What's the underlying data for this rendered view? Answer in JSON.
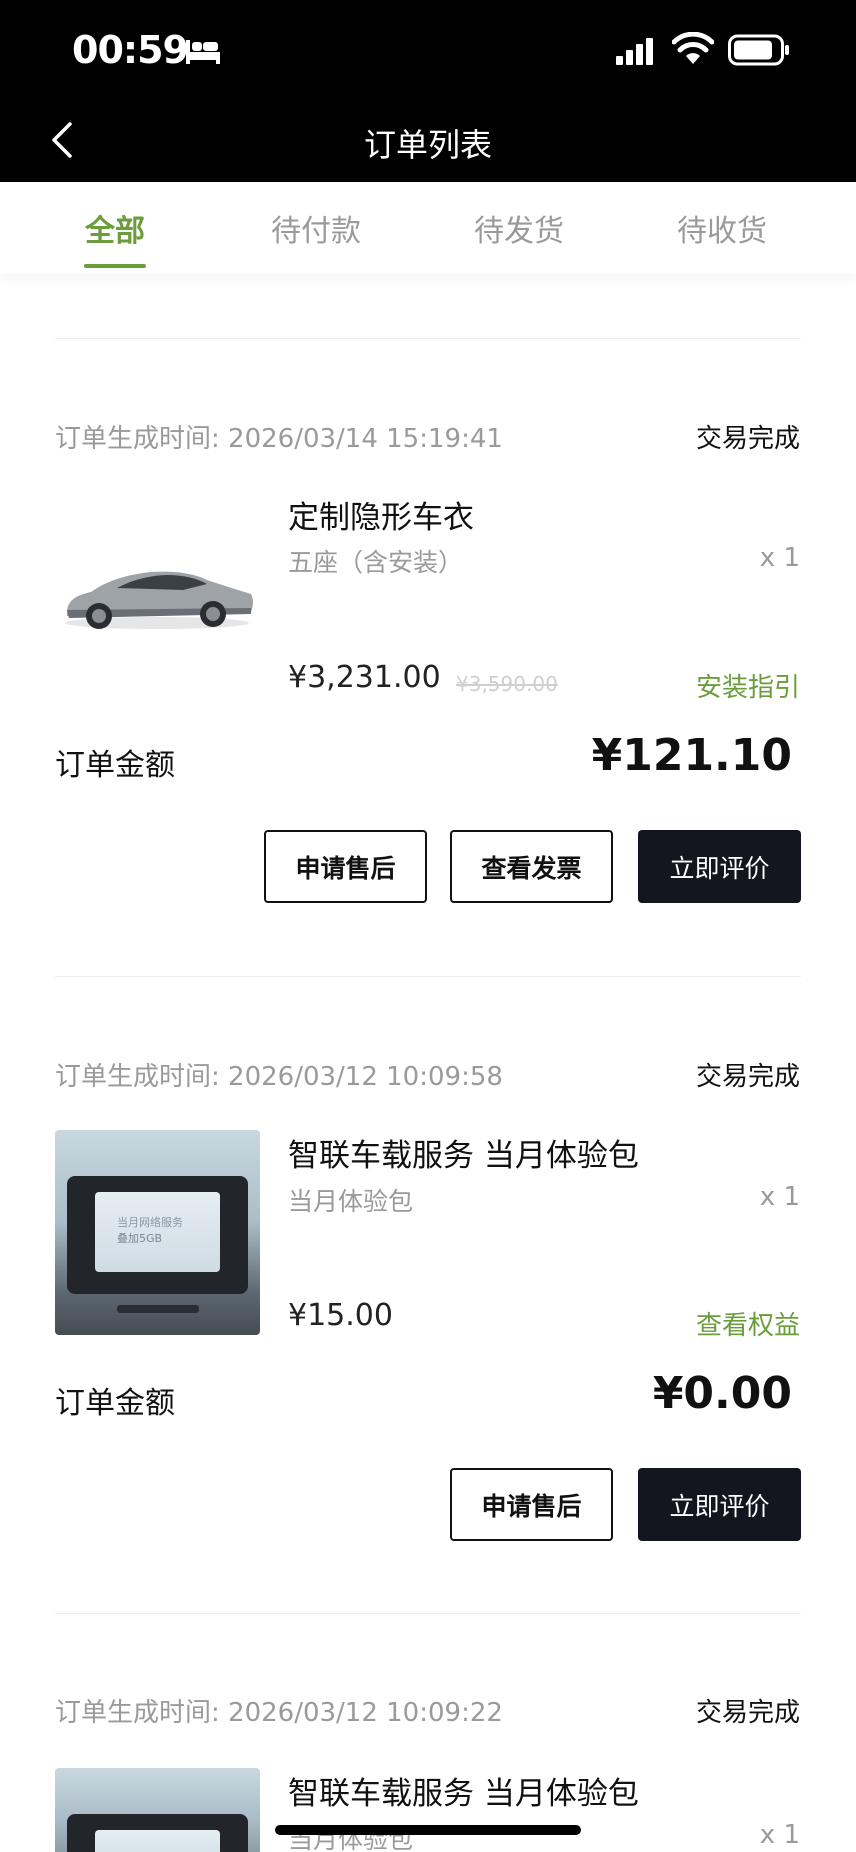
{
  "status_bar": {
    "time": "00:59"
  },
  "nav": {
    "title": "订单列表"
  },
  "tabs": [
    {
      "label": "全部",
      "active": true
    },
    {
      "label": "待付款",
      "active": false
    },
    {
      "label": "待发货",
      "active": false
    },
    {
      "label": "待收货",
      "active": false
    }
  ],
  "orders": [
    {
      "time_label": "订单生成时间: 2026/03/14 15:19:41",
      "status": "交易完成",
      "product": {
        "title": "定制隐形车衣",
        "variant": "五座（含安装）",
        "qty": "x 1",
        "price": "¥3,231.00",
        "original_price": "¥3,590.00",
        "link": "安装指引"
      },
      "amount_label": "订单金额",
      "amount": "¥121.10",
      "buttons": [
        "申请售后",
        "查看发票",
        "立即评价"
      ]
    },
    {
      "time_label": "订单生成时间: 2026/03/12 10:09:58",
      "status": "交易完成",
      "product": {
        "title": "智联车载服务 当月体验包",
        "variant": "当月体验包",
        "qty": "x 1",
        "price": "¥15.00",
        "link": "查看权益",
        "image_text_1": "当月网络服务",
        "image_text_2": "叠加5GB"
      },
      "amount_label": "订单金额",
      "amount": "¥0.00",
      "buttons": [
        "申请售后",
        "立即评价"
      ]
    },
    {
      "time_label": "订单生成时间: 2026/03/12 10:09:22",
      "status": "交易完成",
      "product": {
        "title": "智联车载服务 当月体验包",
        "variant": "当月体验包",
        "qty": "x 1"
      }
    }
  ],
  "colors": {
    "accent": "#6b9d3c",
    "dark_button": "#13161f",
    "muted": "#9a9a9a"
  }
}
